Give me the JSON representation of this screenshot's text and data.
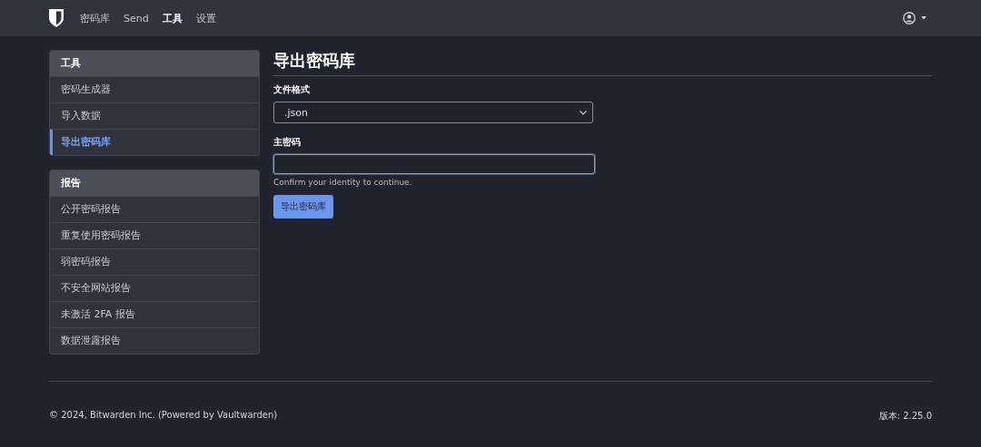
{
  "navbar": {
    "items": [
      {
        "label": "密码库",
        "selected": false
      },
      {
        "label": "Send",
        "selected": false
      },
      {
        "label": "工具",
        "selected": true
      },
      {
        "label": "设置",
        "selected": false
      }
    ]
  },
  "sidebar": [
    {
      "title": "工具",
      "items": [
        {
          "label": "密码生成器",
          "selected": false
        },
        {
          "label": "导入数据",
          "selected": false
        },
        {
          "label": "导出密码库",
          "selected": true
        }
      ]
    },
    {
      "title": "报告",
      "items": [
        {
          "label": "公开密码报告",
          "selected": false
        },
        {
          "label": "重复使用密码报告",
          "selected": false
        },
        {
          "label": "弱密码报告",
          "selected": false
        },
        {
          "label": "不安全网站报告",
          "selected": false
        },
        {
          "label": "未激活 2FA 报告",
          "selected": false
        },
        {
          "label": "数据泄露报告",
          "selected": false
        }
      ]
    }
  ],
  "main": {
    "title": "导出密码库",
    "format": {
      "label": "文件格式",
      "value": ".json"
    },
    "password": {
      "label": "主密码",
      "hint": "Confirm your identity to continue."
    },
    "submit": "导出密码库"
  },
  "footer": {
    "copyright": "© 2024, Bitwarden Inc. (Powered by Vaultwarden)",
    "version": "版本: 2.25.0"
  }
}
